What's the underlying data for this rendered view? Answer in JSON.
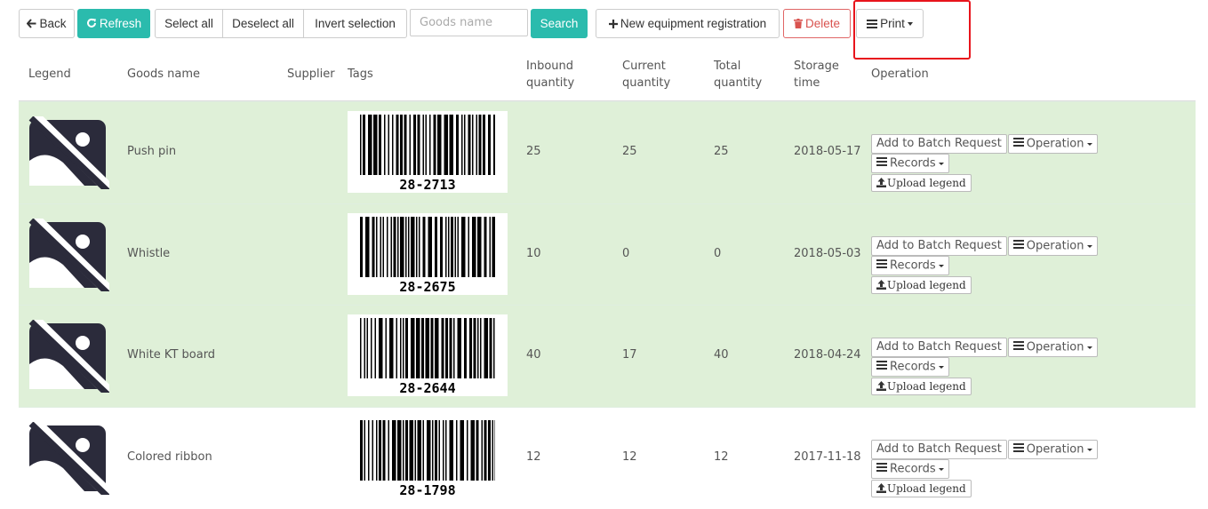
{
  "toolbar": {
    "back_label": "Back",
    "refresh_label": "Refresh",
    "select_all_label": "Select all",
    "deselect_all_label": "Deselect all",
    "invert_selection_label": "Invert selection",
    "search_placeholder": "Goods name",
    "search_value": "",
    "search_label": "Search",
    "new_registration_label": "New equipment registration",
    "delete_label": "Delete",
    "print_label": "Print"
  },
  "table": {
    "headers": {
      "legend": "Legend",
      "goods_name": "Goods name",
      "supplier": "Supplier",
      "tags": "Tags",
      "inbound_1": "Inbound",
      "inbound_2": "quantity",
      "current_1": "Current",
      "current_2": "quantity",
      "total_1": "Total",
      "total_2": "quantity",
      "storage_1": "Storage",
      "storage_2": "time",
      "operation": "Operation"
    },
    "rows": [
      {
        "name": "Push pin",
        "supplier": "",
        "barcode": "28-2713",
        "inbound": "25",
        "current": "25",
        "total": "25",
        "storage_time": "2018-05-17"
      },
      {
        "name": "Whistle",
        "supplier": "",
        "barcode": "28-2675",
        "inbound": "10",
        "current": "0",
        "total": "0",
        "storage_time": "2018-05-03"
      },
      {
        "name": "White KT board",
        "supplier": "",
        "barcode": "28-2644",
        "inbound": "40",
        "current": "17",
        "total": "40",
        "storage_time": "2018-04-24"
      },
      {
        "name": "Colored ribbon",
        "supplier": "",
        "barcode": "28-1798",
        "inbound": "12",
        "current": "12",
        "total": "12",
        "storage_time": "2017-11-18"
      }
    ],
    "row_actions": {
      "batch_label": "Add to Batch Request",
      "operation_label": "Operation",
      "records_label": "Records",
      "upload_label": "Upload legend"
    }
  },
  "colors": {
    "accent": "#2bbbad",
    "row_highlight": "#dff0d8",
    "danger": "#d9534f",
    "annotation_box": "#e8141c"
  },
  "icons": [
    "arrow-left-icon",
    "refresh-icon",
    "plus-icon",
    "trash-icon",
    "list-icon",
    "image-placeholder-icon",
    "upload-icon",
    "caret-down-icon"
  ]
}
